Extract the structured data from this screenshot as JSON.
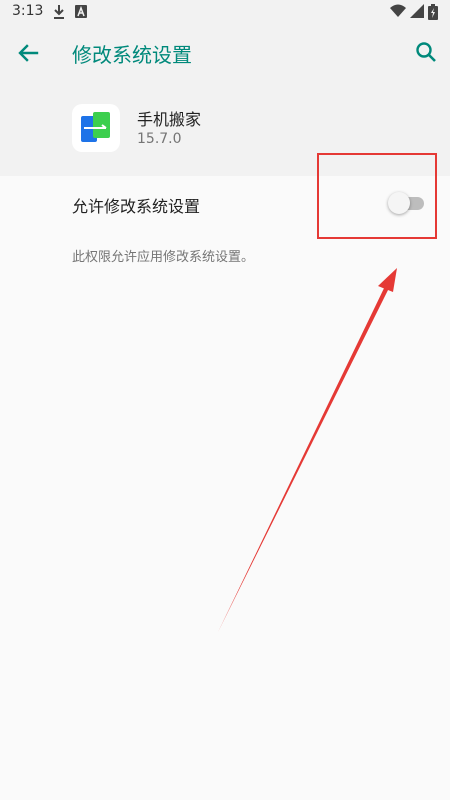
{
  "status_bar": {
    "time": "3:13",
    "icons": [
      "download-icon",
      "font-a-icon",
      "wifi-icon",
      "signal-icon",
      "battery-charging-icon"
    ]
  },
  "toolbar": {
    "title": "修改系统设置",
    "back_icon": "arrow-left-icon",
    "search_icon": "search-icon"
  },
  "app": {
    "name": "手机搬家",
    "version": "15.7.0",
    "icon": "phone-clone-app-icon"
  },
  "setting": {
    "label": "允许修改系统设置",
    "enabled": false,
    "description": "此权限允许应用修改系统设置。"
  },
  "colors": {
    "accent": "#00897b",
    "annotation": "#e53935"
  }
}
